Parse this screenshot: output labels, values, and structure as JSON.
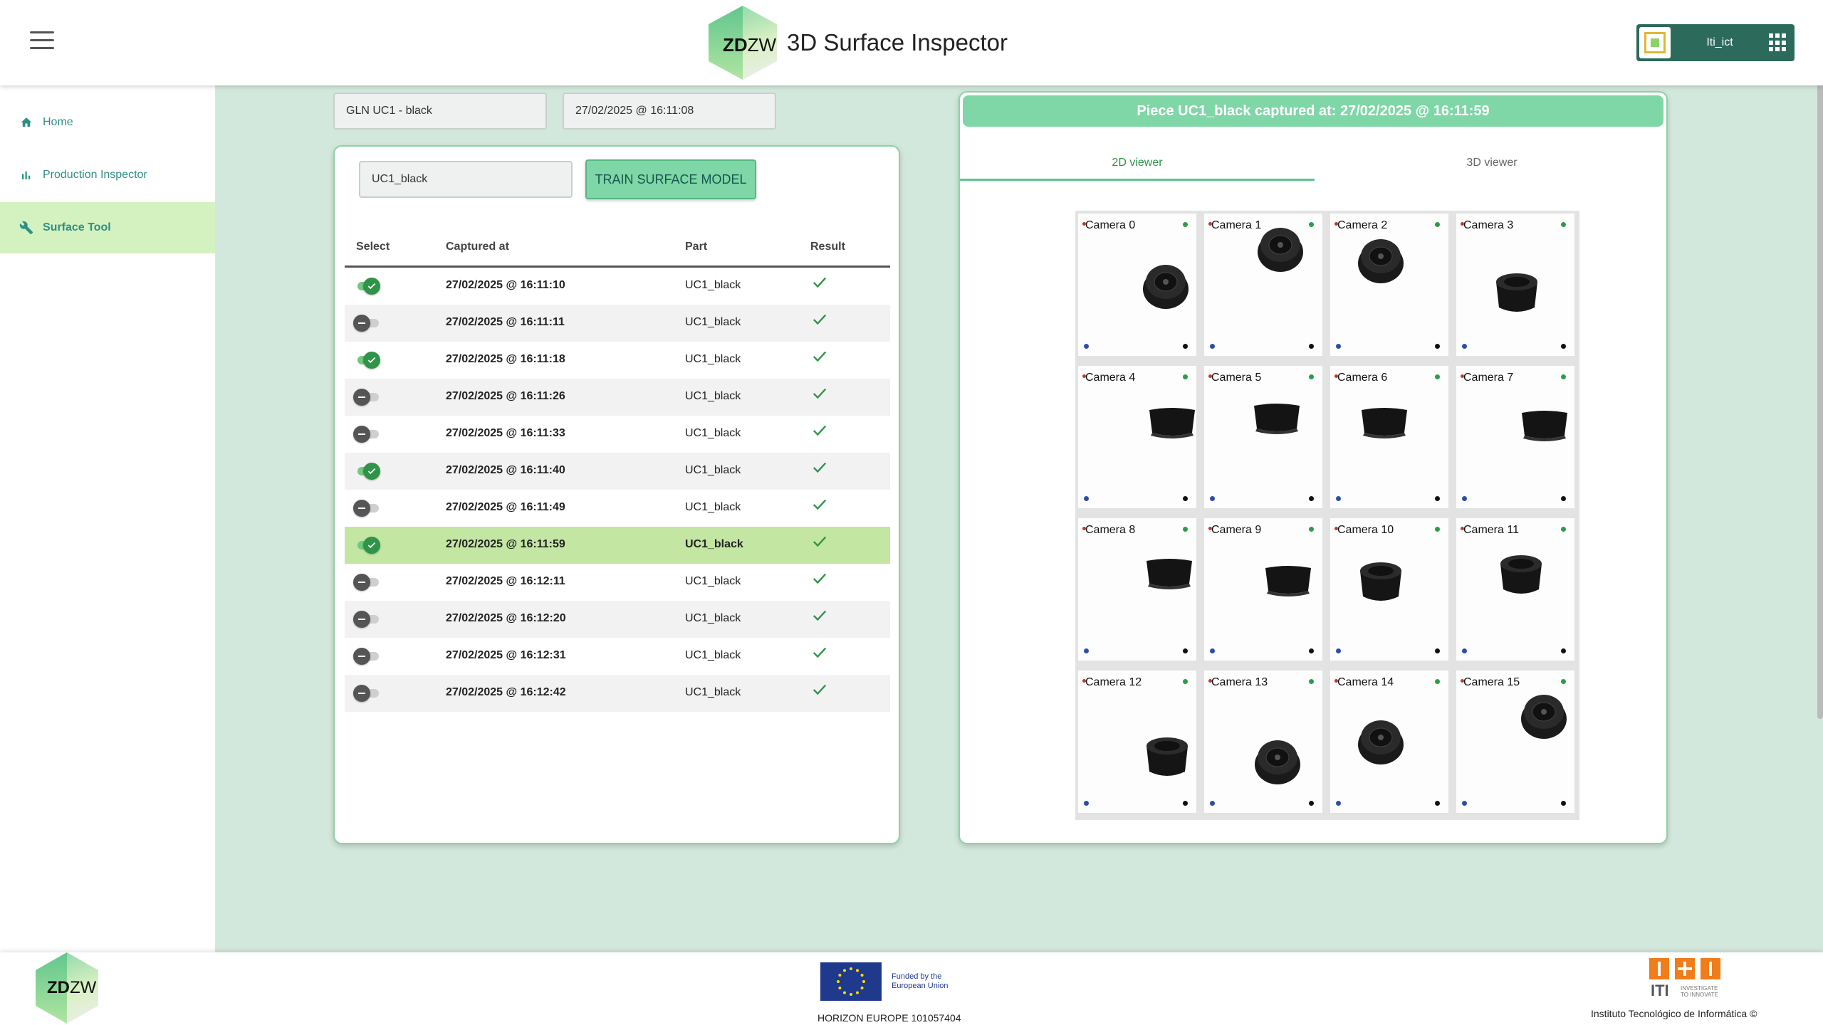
{
  "header": {
    "logo_text_bold": "ZD",
    "logo_text": "ZW",
    "title": "3D Surface Inspector",
    "user": "Iti_ict"
  },
  "sidebar": {
    "items": [
      {
        "label": "Home",
        "icon": "home-icon"
      },
      {
        "label": "Production Inspector",
        "icon": "bar-chart-icon"
      },
      {
        "label": "Surface Tool",
        "icon": "wrench-icon",
        "active": true
      }
    ]
  },
  "filters": {
    "model": "GLN UC1 - black",
    "datetime": "27/02/2025 @ 16:11:08"
  },
  "left_panel": {
    "part_input": "UC1_black",
    "train_button": "TRAIN SURFACE MODEL",
    "columns": [
      "Select",
      "Captured at",
      "Part",
      "Result"
    ],
    "rows": [
      {
        "selected": true,
        "captured_at": "27/02/2025 @ 16:11:10",
        "part": "UC1_black",
        "result": "ok"
      },
      {
        "selected": false,
        "captured_at": "27/02/2025 @ 16:11:11",
        "part": "UC1_black",
        "result": "ok"
      },
      {
        "selected": true,
        "captured_at": "27/02/2025 @ 16:11:18",
        "part": "UC1_black",
        "result": "ok"
      },
      {
        "selected": false,
        "captured_at": "27/02/2025 @ 16:11:26",
        "part": "UC1_black",
        "result": "ok"
      },
      {
        "selected": false,
        "captured_at": "27/02/2025 @ 16:11:33",
        "part": "UC1_black",
        "result": "ok"
      },
      {
        "selected": true,
        "captured_at": "27/02/2025 @ 16:11:40",
        "part": "UC1_black",
        "result": "ok"
      },
      {
        "selected": false,
        "captured_at": "27/02/2025 @ 16:11:49",
        "part": "UC1_black",
        "result": "ok"
      },
      {
        "selected": true,
        "captured_at": "27/02/2025 @ 16:11:59",
        "part": "UC1_black",
        "result": "ok",
        "highlighted": true
      },
      {
        "selected": false,
        "captured_at": "27/02/2025 @ 16:12:11",
        "part": "UC1_black",
        "result": "ok"
      },
      {
        "selected": false,
        "captured_at": "27/02/2025 @ 16:12:20",
        "part": "UC1_black",
        "result": "ok"
      },
      {
        "selected": false,
        "captured_at": "27/02/2025 @ 16:12:31",
        "part": "UC1_black",
        "result": "ok"
      },
      {
        "selected": false,
        "captured_at": "27/02/2025 @ 16:12:42",
        "part": "UC1_black",
        "result": "ok"
      }
    ]
  },
  "right_panel": {
    "banner": "Piece UC1_black captured at: 27/02/2025 @ 16:11:59",
    "tabs": [
      "2D viewer",
      "3D viewer"
    ],
    "active_tab": "2D viewer",
    "cameras": [
      "Camera 0",
      "Camera 1",
      "Camera 2",
      "Camera 3",
      "Camera 4",
      "Camera 5",
      "Camera 6",
      "Camera 7",
      "Camera 8",
      "Camera 9",
      "Camera 10",
      "Camera 11",
      "Camera 12",
      "Camera 13",
      "Camera 14",
      "Camera 15"
    ]
  },
  "footer": {
    "eu_line1": "Funded by the",
    "eu_line2": "European Union",
    "horizon": "HORIZON EUROPE 101057404",
    "iti_tagline1": "INVESTIGATE",
    "iti_tagline2": "TO INNOVATE",
    "iti_copyright": "Instituto Tecnológico de Informática ©"
  },
  "colors": {
    "accent": "#7fd6a6",
    "main_bg": "#d3e8dc",
    "active_nav": "#d4f2c0",
    "highlight_row": "#c3e6a3",
    "user_chip": "#2c6b5c",
    "ok_check": "#2f9447"
  }
}
